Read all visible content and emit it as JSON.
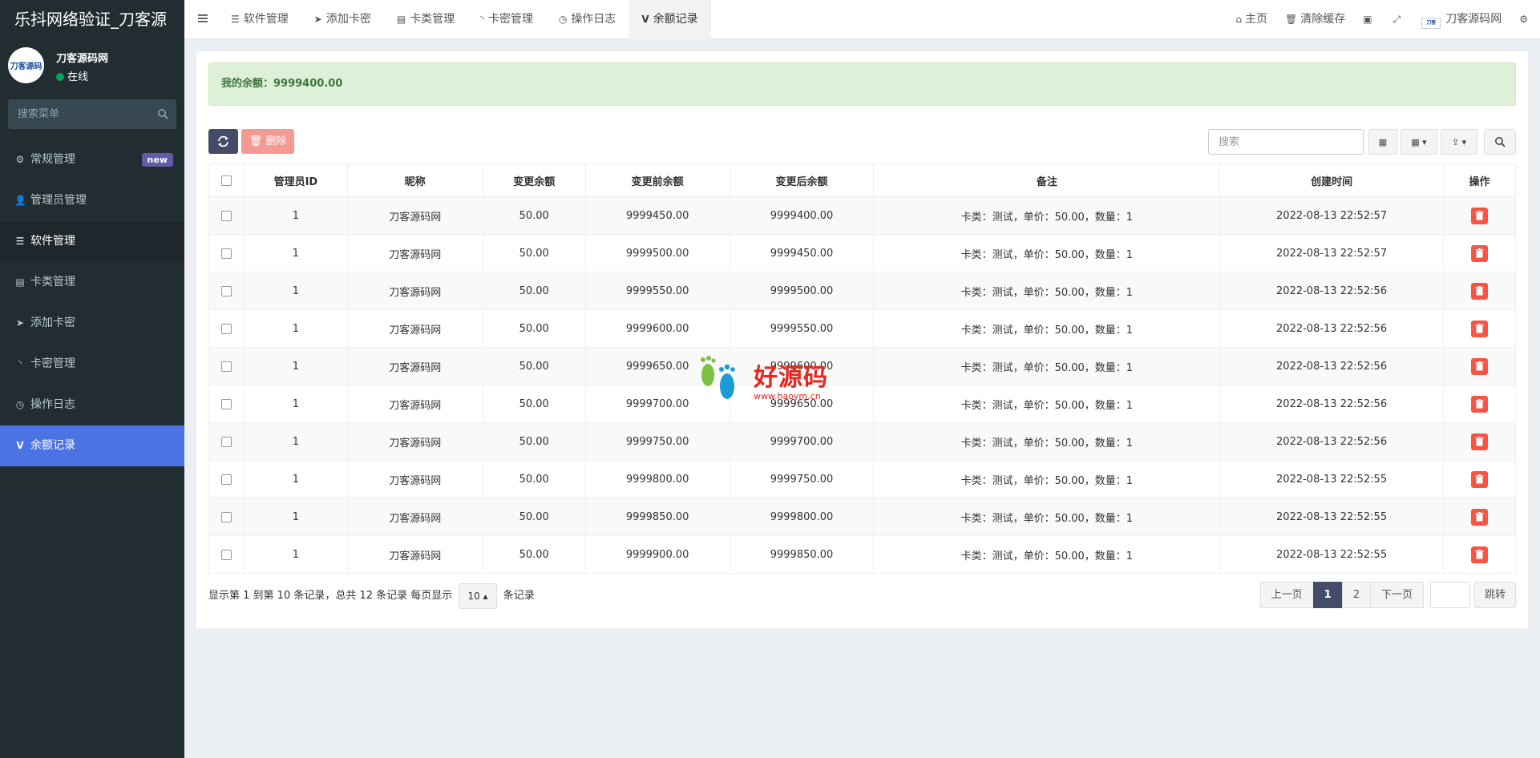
{
  "brand": "乐抖网络验证_刀客源",
  "user": {
    "name": "刀客源码网",
    "status": "在线",
    "avatar_text": "刀客源码"
  },
  "sidebar": {
    "search_placeholder": "搜索菜单",
    "items": [
      {
        "label": "常规管理",
        "icon": "gears-icon",
        "badge": "new"
      },
      {
        "label": "管理员管理",
        "icon": "user-icon"
      },
      {
        "label": "软件管理",
        "icon": "list-icon"
      },
      {
        "label": "卡类管理",
        "icon": "server-icon"
      },
      {
        "label": "添加卡密",
        "icon": "paper-plane-icon"
      },
      {
        "label": "卡密管理",
        "icon": "rss-icon"
      },
      {
        "label": "操作日志",
        "icon": "clock-icon"
      },
      {
        "label": "余额记录",
        "icon": "vimeo-icon"
      }
    ]
  },
  "topbar": {
    "tabs": [
      {
        "label": "软件管理"
      },
      {
        "label": "添加卡密"
      },
      {
        "label": "卡类管理"
      },
      {
        "label": "卡密管理"
      },
      {
        "label": "操作日志"
      },
      {
        "label": "余额记录"
      }
    ],
    "right": {
      "home": "主页",
      "clear_cache": "清除缓存",
      "site_name": "刀客源码网"
    }
  },
  "alert": {
    "text": "我的余额：9999400.00"
  },
  "toolbar": {
    "delete_label": "删除",
    "search_placeholder": "搜索"
  },
  "table": {
    "headers": [
      "管理员ID",
      "昵称",
      "变更余额",
      "变更前余额",
      "变更后余额",
      "备注",
      "创建时间",
      "操作"
    ],
    "rows": [
      {
        "admin_id": "1",
        "nickname": "刀客源码网",
        "change": "50.00",
        "before": "9999450.00",
        "after": "9999400.00",
        "remark": "卡类：测试，单价：50.00，数量：1",
        "created": "2022-08-13 22:52:57"
      },
      {
        "admin_id": "1",
        "nickname": "刀客源码网",
        "change": "50.00",
        "before": "9999500.00",
        "after": "9999450.00",
        "remark": "卡类：测试，单价：50.00，数量：1",
        "created": "2022-08-13 22:52:57"
      },
      {
        "admin_id": "1",
        "nickname": "刀客源码网",
        "change": "50.00",
        "before": "9999550.00",
        "after": "9999500.00",
        "remark": "卡类：测试，单价：50.00，数量：1",
        "created": "2022-08-13 22:52:56"
      },
      {
        "admin_id": "1",
        "nickname": "刀客源码网",
        "change": "50.00",
        "before": "9999600.00",
        "after": "9999550.00",
        "remark": "卡类：测试，单价：50.00，数量：1",
        "created": "2022-08-13 22:52:56"
      },
      {
        "admin_id": "1",
        "nickname": "刀客源码网",
        "change": "50.00",
        "before": "9999650.00",
        "after": "9999600.00",
        "remark": "卡类：测试，单价：50.00，数量：1",
        "created": "2022-08-13 22:52:56"
      },
      {
        "admin_id": "1",
        "nickname": "刀客源码网",
        "change": "50.00",
        "before": "9999700.00",
        "after": "9999650.00",
        "remark": "卡类：测试，单价：50.00，数量：1",
        "created": "2022-08-13 22:52:56"
      },
      {
        "admin_id": "1",
        "nickname": "刀客源码网",
        "change": "50.00",
        "before": "9999750.00",
        "after": "9999700.00",
        "remark": "卡类：测试，单价：50.00，数量：1",
        "created": "2022-08-13 22:52:56"
      },
      {
        "admin_id": "1",
        "nickname": "刀客源码网",
        "change": "50.00",
        "before": "9999800.00",
        "after": "9999750.00",
        "remark": "卡类：测试，单价：50.00，数量：1",
        "created": "2022-08-13 22:52:55"
      },
      {
        "admin_id": "1",
        "nickname": "刀客源码网",
        "change": "50.00",
        "before": "9999850.00",
        "after": "9999800.00",
        "remark": "卡类：测试，单价：50.00，数量：1",
        "created": "2022-08-13 22:52:55"
      },
      {
        "admin_id": "1",
        "nickname": "刀客源码网",
        "change": "50.00",
        "before": "9999900.00",
        "after": "9999850.00",
        "remark": "卡类：测试，单价：50.00，数量：1",
        "created": "2022-08-13 22:52:55"
      }
    ]
  },
  "pagination": {
    "info_prefix": "显示第 1 到第 10 条记录，总共 12 条记录 每页显示",
    "page_size": "10",
    "info_suffix": "条记录",
    "prev": "上一页",
    "pages": [
      "1",
      "2"
    ],
    "next": "下一页",
    "go": "跳转"
  },
  "watermark": {
    "text": "好源码",
    "sub": "www.haoym.cn"
  },
  "colors": {
    "sidebar_bg": "#222d32",
    "selected": "#4c73e3",
    "primary_btn": "#444c69",
    "danger": "#f75444",
    "alert_bg": "#dff0d8"
  }
}
